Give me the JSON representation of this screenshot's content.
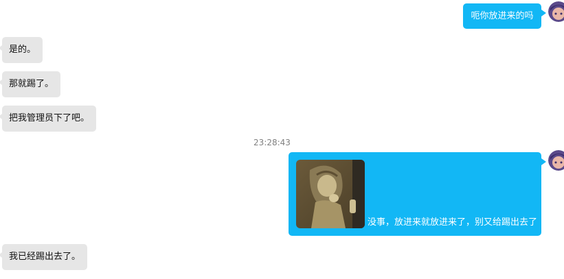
{
  "colors": {
    "outgoing_bubble": "#12b7f5",
    "incoming_bubble": "#e6e6e6",
    "timestamp_text": "#808080"
  },
  "messages": [
    {
      "side": "right",
      "text": "呃你放进来的吗"
    },
    {
      "side": "left",
      "text": "是的。"
    },
    {
      "side": "left",
      "text": "那就踢了。"
    },
    {
      "side": "left",
      "text": "把我管理员下了吧。"
    },
    {
      "side": "right",
      "has_image": true,
      "text": "没事，放进来就放进来了，别又给踢出去了"
    },
    {
      "side": "left",
      "text": "我已经踢出去了。"
    }
  ],
  "timestamp": "23:28:43",
  "icons": {
    "self_avatar": "user-avatar-icon",
    "shared_image": "anime-girl-image"
  }
}
